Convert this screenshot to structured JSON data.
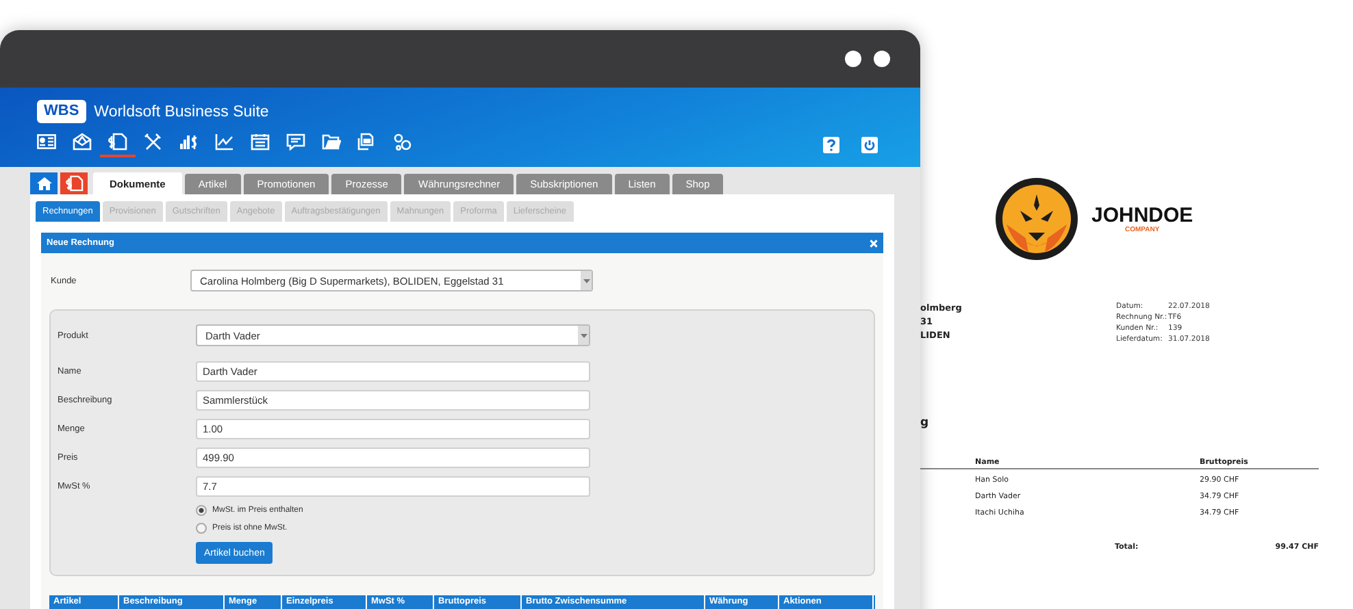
{
  "app": {
    "logo": "WBS",
    "title": "Worldsoft Business Suite"
  },
  "toolbar": [
    {
      "selected": false
    },
    {
      "selected": false
    },
    {
      "selected": true
    },
    {
      "selected": false
    },
    {
      "selected": false
    },
    {
      "selected": false
    },
    {
      "selected": false
    },
    {
      "selected": false
    },
    {
      "selected": false
    },
    {
      "selected": false
    },
    {
      "selected": false
    }
  ],
  "main_tabs": [
    {
      "label": "Dokumente",
      "selected": true
    },
    {
      "label": "Artikel",
      "selected": false
    },
    {
      "label": "Promotionen",
      "selected": false
    },
    {
      "label": "Prozesse",
      "selected": false
    },
    {
      "label": "Währungsrechner",
      "selected": false
    },
    {
      "label": "Subskriptionen",
      "selected": false
    },
    {
      "label": "Listen",
      "selected": false
    },
    {
      "label": "Shop",
      "selected": false
    }
  ],
  "sub_tabs": [
    {
      "label": "Rechnungen",
      "selected": true
    },
    {
      "label": "Provisionen",
      "selected": false
    },
    {
      "label": "Gutschriften",
      "selected": false
    },
    {
      "label": "Angebote",
      "selected": false
    },
    {
      "label": "Auftragsbestätigungen",
      "selected": false
    },
    {
      "label": "Mahnungen",
      "selected": false
    },
    {
      "label": "Proforma",
      "selected": false
    },
    {
      "label": "Lieferscheine",
      "selected": false
    }
  ],
  "dialog": {
    "title": "Neue Rechnung",
    "customer": {
      "label": "Kunde",
      "value": "Carolina Holmberg (Big D Supermarkets), BOLIDEN, Eggelstad 31"
    },
    "fields": [
      {
        "kind": "select",
        "label": "Produkt",
        "value": "Darth Vader"
      },
      {
        "kind": "text",
        "label": "Name",
        "value": "Darth Vader"
      },
      {
        "kind": "text",
        "label": "Beschreibung",
        "value": "Sammlerstück"
      },
      {
        "kind": "text",
        "label": "Menge",
        "value": "1.00"
      },
      {
        "kind": "text",
        "label": "Preis",
        "value": "499.90"
      },
      {
        "kind": "text",
        "label": "MwSt %",
        "value": "7.7"
      }
    ],
    "vat_options": [
      {
        "label": "MwSt. im Preis enthalten",
        "selected": true
      },
      {
        "label": "Preis ist ohne MwSt.",
        "selected": false
      }
    ],
    "submit": "Artikel buchen",
    "table_columns": [
      "Artikel",
      "Beschreibung",
      "Menge",
      "Einzelpreis",
      "MwSt %",
      "Bruttopreis",
      "Brutto Zwischensumme",
      "Währung",
      "Aktionen"
    ]
  },
  "invoice": {
    "company": "JOHNDOE",
    "company_sub": "COMPANY",
    "address": [
      "olmberg",
      "31",
      "LIDEN"
    ],
    "meta": [
      {
        "label": "Datum:",
        "value": "22.07.2018"
      },
      {
        "label": "Rechnung Nr.:",
        "value": "TF6"
      },
      {
        "label": "Kunden Nr.:",
        "value": "139"
      },
      {
        "label": "Lieferdatum:",
        "value": "31.07.2018"
      }
    ],
    "heading": "g",
    "columns": [
      "Name",
      "Bruttopreis"
    ],
    "rows": [
      {
        "name": "Han Solo",
        "price": "29.90 CHF"
      },
      {
        "name": "Darth Vader",
        "price": "34.79 CHF"
      },
      {
        "name": "Itachi Uchiha",
        "price": "34.79 CHF"
      }
    ],
    "total_label": "Total:",
    "total": "99.47 CHF"
  }
}
